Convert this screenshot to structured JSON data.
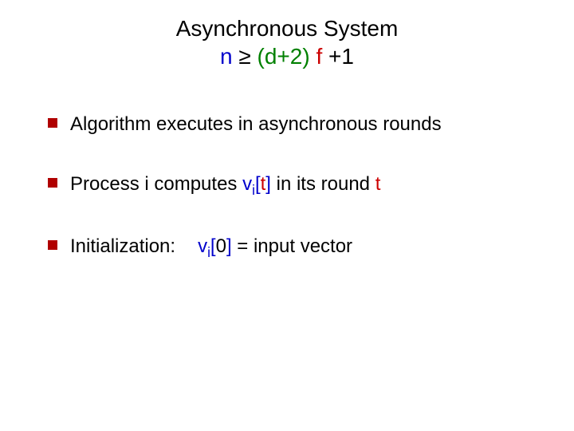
{
  "title": {
    "line1": "Asynchronous System",
    "line2": {
      "n": "n",
      "ge": " ≥ ",
      "d2": "(d+2)",
      "f": " f ",
      "plus1": "+1"
    }
  },
  "bullets": {
    "b1": {
      "text": "Algorithm executes in asynchronous rounds"
    },
    "b2": {
      "pre": "Process i computes ",
      "v": "v",
      "i": "i",
      "lbr": "[",
      "t": "t",
      "rbr": "]",
      "mid": "  in its round ",
      "t2": "t"
    },
    "b3": {
      "label": "Initialization:",
      "v": "v",
      "i": "i",
      "lbr": "[",
      "zero": "0",
      "rbr": "]",
      "eq": " = input vector"
    }
  }
}
